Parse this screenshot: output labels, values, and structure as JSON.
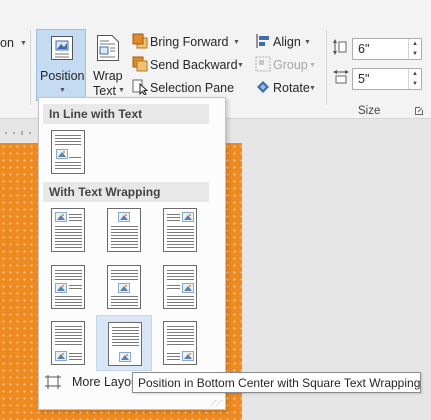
{
  "ribbon": {
    "partial_left_label": "on",
    "position_label": "Position",
    "wrap_text_line1": "Wrap",
    "wrap_text_line2": "Text",
    "bring_forward": "Bring Forward",
    "send_backward": "Send Backward",
    "selection_pane": "Selection Pane",
    "align": "Align",
    "group": "Group",
    "rotate": "Rotate",
    "height_value": "6\"",
    "width_value": "5\"",
    "size_group_label": "Size"
  },
  "dropdown": {
    "inline_header": "In Line with Text",
    "wrapping_header": "With Text Wrapping",
    "more_layout_label": "More Layout Options..."
  },
  "tooltip": "Position in Bottom Center with Square Text Wrapping",
  "colors": {
    "page_orange": "#ee8a1f",
    "pressed_blue": "#c5dbf1"
  }
}
